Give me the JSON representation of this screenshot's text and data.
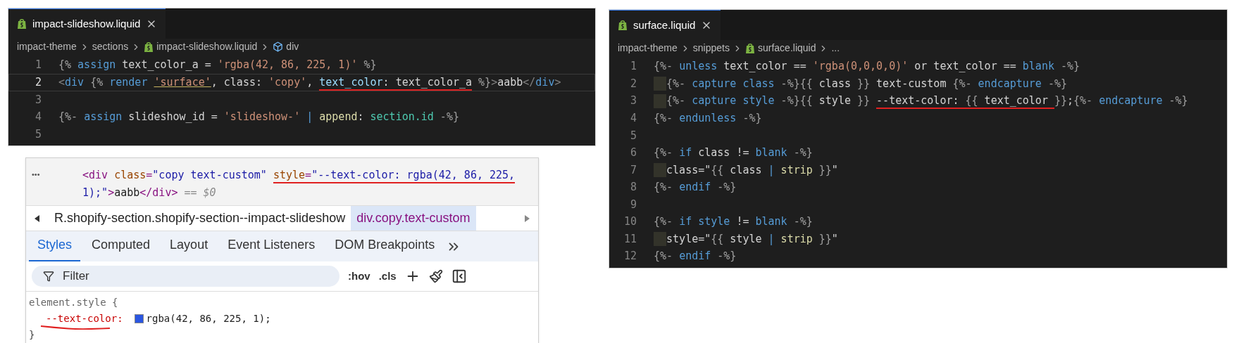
{
  "editors": [
    {
      "tab": {
        "title": "impact-slideshow.liquid",
        "selected": true
      },
      "breadcrumb": [
        {
          "kind": "folder",
          "text": "impact-theme"
        },
        {
          "kind": "folder",
          "text": "sections"
        },
        {
          "kind": "file",
          "text": "impact-slideshow.liquid"
        },
        {
          "kind": "symbol",
          "text": "div"
        }
      ],
      "lines": [
        {
          "number": "1",
          "current": false,
          "tokens": [
            {
              "kind": "punct",
              "text": "{% "
            },
            {
              "kind": "keyword",
              "text": "assign"
            },
            {
              "kind": "plain",
              "text": " text_color_a = "
            },
            {
              "kind": "string",
              "text": "'rgba(42, 86, 225, 1)'"
            },
            {
              "kind": "punct",
              "text": " %}"
            }
          ]
        },
        {
          "number": "2",
          "current": true,
          "tokens": [
            {
              "kind": "tag",
              "text": "<"
            },
            {
              "kind": "keyword",
              "text": "div"
            },
            {
              "kind": "punct",
              "text": " {% "
            },
            {
              "kind": "keyword",
              "text": "render "
            },
            {
              "kind": "string",
              "text": "'surface'",
              "link": true
            },
            {
              "kind": "plain",
              "text": ", class: "
            },
            {
              "kind": "string",
              "text": "'copy'"
            },
            {
              "kind": "plain",
              "text": ", "
            },
            {
              "kind": "param",
              "text": "text_color",
              "mark": true
            },
            {
              "kind": "plain",
              "text": ": text_color_a",
              "mark": true
            },
            {
              "kind": "punct",
              "text": " %}"
            },
            {
              "kind": "tag",
              "text": ">"
            },
            {
              "kind": "plain",
              "text": "aabb"
            },
            {
              "kind": "tag",
              "text": "</"
            },
            {
              "kind": "keyword",
              "text": "div"
            },
            {
              "kind": "tag",
              "text": ">"
            }
          ]
        },
        {
          "number": "3",
          "current": false
        },
        {
          "number": "4",
          "current": false,
          "tokens": [
            {
              "kind": "punct",
              "text": "{%- "
            },
            {
              "kind": "keyword",
              "text": "assign"
            },
            {
              "kind": "plain",
              "text": " slideshow_id = "
            },
            {
              "kind": "string",
              "text": "'slideshow-'"
            },
            {
              "kind": "keyword",
              "text": " | "
            },
            {
              "kind": "func",
              "text": "append"
            },
            {
              "kind": "plain",
              "text": ": "
            },
            {
              "kind": "type",
              "text": "section.id"
            },
            {
              "kind": "punct",
              "text": " -%}"
            }
          ]
        },
        {
          "number": "5",
          "current": false
        }
      ]
    },
    {
      "tab": {
        "title": "surface.liquid",
        "selected": true
      },
      "breadcrumb": [
        {
          "kind": "folder",
          "text": "impact-theme"
        },
        {
          "kind": "folder",
          "text": "snippets"
        },
        {
          "kind": "file",
          "text": "surface.liquid"
        },
        {
          "kind": "more",
          "text": "..."
        }
      ],
      "lines": [
        {
          "number": "1",
          "current": false,
          "indent": false,
          "tokens": [
            {
              "kind": "punct",
              "text": "{%- "
            },
            {
              "kind": "keyword",
              "text": "unless"
            },
            {
              "kind": "plain",
              "text": " text_color == "
            },
            {
              "kind": "string",
              "text": "'rgba(0,0,0,0)'"
            },
            {
              "kind": "plain",
              "text": " or text_color == "
            },
            {
              "kind": "keyword",
              "text": "blank"
            },
            {
              "kind": "punct",
              "text": " -%}"
            }
          ]
        },
        {
          "number": "2",
          "current": false,
          "indent": true,
          "tokens": [
            {
              "kind": "punct",
              "text": "{%- "
            },
            {
              "kind": "keyword",
              "text": "capture class"
            },
            {
              "kind": "punct",
              "text": " -%}{{"
            },
            {
              "kind": "plain",
              "text": " class "
            },
            {
              "kind": "punct",
              "text": "}}"
            },
            {
              "kind": "plain",
              "text": " text-custom "
            },
            {
              "kind": "punct",
              "text": "{%- "
            },
            {
              "kind": "keyword",
              "text": "endcapture"
            },
            {
              "kind": "punct",
              "text": " -%}"
            }
          ]
        },
        {
          "number": "3",
          "current": false,
          "indent": true,
          "tokens": [
            {
              "kind": "punct",
              "text": "{%- "
            },
            {
              "kind": "keyword",
              "text": "capture style"
            },
            {
              "kind": "punct",
              "text": " -%}{{"
            },
            {
              "kind": "plain",
              "text": " style "
            },
            {
              "kind": "punct",
              "text": "}} "
            },
            {
              "kind": "plain",
              "text": "--text-color: ",
              "mark": true
            },
            {
              "kind": "punct",
              "text": "{{",
              "mark": true
            },
            {
              "kind": "plain",
              "text": " text_color ",
              "mark": true
            },
            {
              "kind": "punct",
              "text": "}}"
            },
            {
              "kind": "plain",
              "text": ";"
            },
            {
              "kind": "punct",
              "text": "{%- "
            },
            {
              "kind": "keyword",
              "text": "endcapture"
            },
            {
              "kind": "punct",
              "text": " -%}"
            }
          ]
        },
        {
          "number": "4",
          "current": false,
          "indent": false,
          "tokens": [
            {
              "kind": "punct",
              "text": "{%- "
            },
            {
              "kind": "keyword",
              "text": "endunless"
            },
            {
              "kind": "punct",
              "text": " -%}"
            }
          ]
        },
        {
          "number": "5",
          "current": false,
          "indent": false
        },
        {
          "number": "6",
          "current": false,
          "indent": false,
          "tokens": [
            {
              "kind": "punct",
              "text": "{%- "
            },
            {
              "kind": "keyword",
              "text": "if"
            },
            {
              "kind": "plain",
              "text": " class != "
            },
            {
              "kind": "keyword",
              "text": "blank"
            },
            {
              "kind": "punct",
              "text": " -%}"
            }
          ]
        },
        {
          "number": "7",
          "current": false,
          "indent": true,
          "tokens": [
            {
              "kind": "plain",
              "text": "class=\""
            },
            {
              "kind": "punct",
              "text": "{{"
            },
            {
              "kind": "plain",
              "text": " class "
            },
            {
              "kind": "keyword",
              "text": "| "
            },
            {
              "kind": "func",
              "text": "strip"
            },
            {
              "kind": "punct",
              "text": " }}"
            },
            {
              "kind": "plain",
              "text": "\""
            }
          ]
        },
        {
          "number": "8",
          "current": false,
          "indent": false,
          "tokens": [
            {
              "kind": "punct",
              "text": "{%- "
            },
            {
              "kind": "keyword",
              "text": "endif"
            },
            {
              "kind": "punct",
              "text": " -%}"
            }
          ]
        },
        {
          "number": "9",
          "current": false,
          "indent": false
        },
        {
          "number": "10",
          "current": false,
          "indent": false,
          "tokens": [
            {
              "kind": "punct",
              "text": "{%- "
            },
            {
              "kind": "keyword",
              "text": "if style"
            },
            {
              "kind": "plain",
              "text": " != "
            },
            {
              "kind": "keyword",
              "text": "blank"
            },
            {
              "kind": "punct",
              "text": " -%}"
            }
          ]
        },
        {
          "number": "11",
          "current": false,
          "indent": true,
          "tokens": [
            {
              "kind": "plain",
              "text": "style=\""
            },
            {
              "kind": "punct",
              "text": "{{"
            },
            {
              "kind": "plain",
              "text": " style "
            },
            {
              "kind": "keyword",
              "text": "| "
            },
            {
              "kind": "func",
              "text": "strip"
            },
            {
              "kind": "punct",
              "text": " }}"
            },
            {
              "kind": "plain",
              "text": "\""
            }
          ]
        },
        {
          "number": "12",
          "current": false,
          "indent": false,
          "tokens": [
            {
              "kind": "punct",
              "text": "{%- "
            },
            {
              "kind": "keyword",
              "text": "endif"
            },
            {
              "kind": "punct",
              "text": " -%}"
            }
          ]
        }
      ]
    }
  ],
  "devtools": {
    "row_menu": "•••",
    "dom_lines": [
      {
        "tokens": [
          {
            "kind": "tag",
            "text": "<div"
          },
          {
            "kind": "attr",
            "text": " class"
          },
          {
            "kind": "tag",
            "text": "="
          },
          {
            "kind": "value",
            "text": "\"copy text-custom\" "
          },
          {
            "kind": "attr",
            "text": "style",
            "mark": true
          },
          {
            "kind": "tag",
            "text": "=",
            "mark": true
          },
          {
            "kind": "value",
            "text": "\"--text-color: rgba(42, 86, 225,",
            "mark": true
          }
        ]
      },
      {
        "tokens": [
          {
            "kind": "value",
            "text": "1);\""
          },
          {
            "kind": "tag",
            "text": ">"
          },
          {
            "kind": "text",
            "text": "aabb"
          },
          {
            "kind": "tag",
            "text": "</div>"
          },
          {
            "kind": "dim",
            "text": " == $0"
          }
        ]
      }
    ],
    "breadcrumb": [
      {
        "text": "R.shopify-section.shopify-section--impact-slideshow",
        "selected": false
      },
      {
        "text": "div.copy.text-custom",
        "selected": true
      }
    ],
    "tabs": [
      {
        "label": "Styles",
        "selected": true
      },
      {
        "label": "Computed",
        "selected": false
      },
      {
        "label": "Layout",
        "selected": false
      },
      {
        "label": "Event Listeners",
        "selected": false
      },
      {
        "label": "DOM Breakpoints",
        "selected": false
      }
    ],
    "filter": {
      "placeholder": "Filter"
    },
    "toggles": [
      ":hov",
      ".cls"
    ],
    "rule": {
      "selector": "element.style {",
      "declarations": [
        {
          "property": "--text-color:",
          "value": "rgba(42, 86, 225, 1);",
          "color": "#2a56e1",
          "mark": true
        }
      ],
      "closing": "}"
    }
  }
}
